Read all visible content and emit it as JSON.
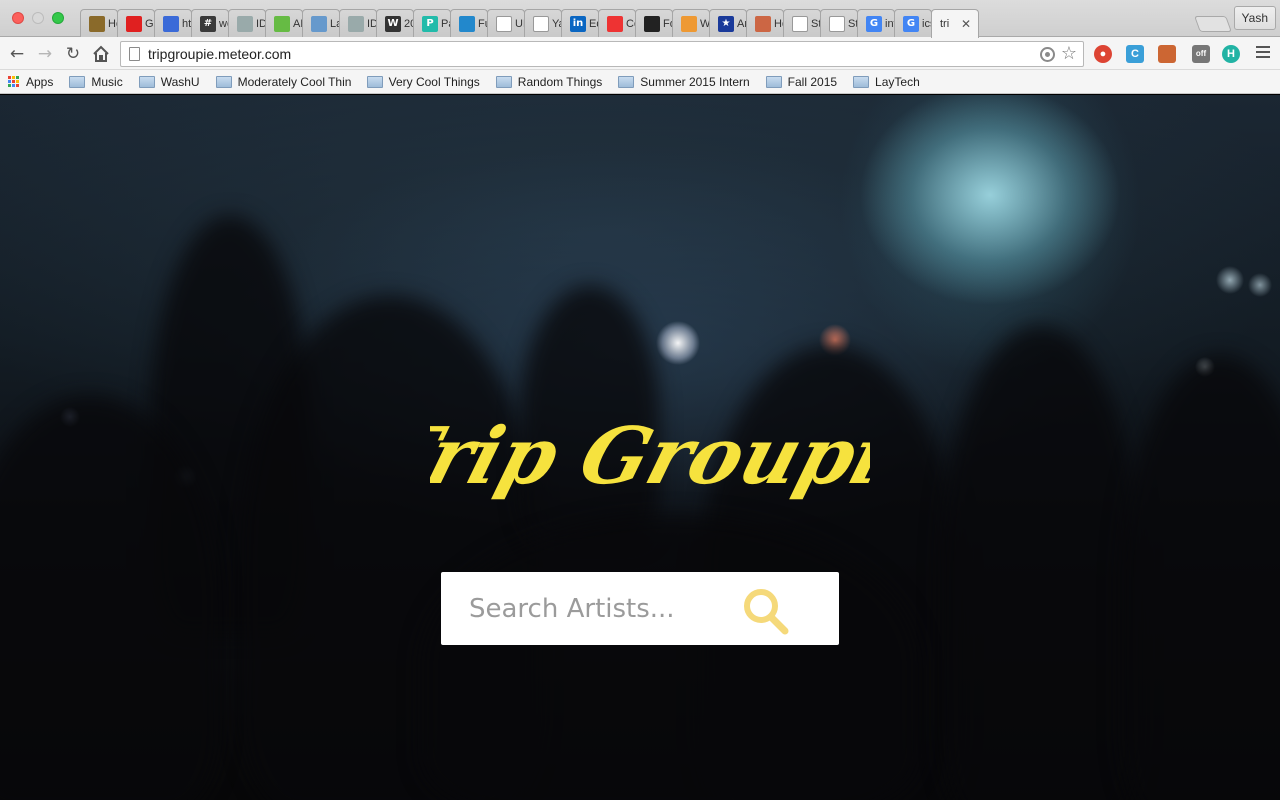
{
  "browser": {
    "profile_name": "Yash",
    "active_tab_title": "tri",
    "tabs": [
      {
        "title": "Ho",
        "icon": "dictionary-icon",
        "color": "#8a6a2a"
      },
      {
        "title": "Go",
        "icon": "red-square-icon",
        "color": "#e02020"
      },
      {
        "title": "htt",
        "icon": "mail-icon",
        "color": "#3a6ad8"
      },
      {
        "title": "we",
        "icon": "hash-icon",
        "color": "#3a3a3a"
      },
      {
        "title": "IDI",
        "icon": "bulb-icon",
        "color": "#9aa"
      },
      {
        "title": "AE",
        "icon": "leaf-icon",
        "color": "#6b4"
      },
      {
        "title": "La",
        "icon": "rocket-icon",
        "color": "#69c"
      },
      {
        "title": "ID",
        "icon": "bulb-icon",
        "color": "#9aa"
      },
      {
        "title": "20",
        "icon": "w-icon",
        "color": "#333"
      },
      {
        "title": "Pa",
        "icon": "p-icon",
        "color": "#2ba"
      },
      {
        "title": "Fu",
        "icon": "drop-icon",
        "color": "#28c"
      },
      {
        "title": "UF",
        "icon": "page-icon",
        "color": "#bbb"
      },
      {
        "title": "Ya",
        "icon": "page-icon",
        "color": "#bbb"
      },
      {
        "title": "Ed",
        "icon": "linkedin-icon",
        "color": "#0a66c2"
      },
      {
        "title": "Co",
        "icon": "color-wheel-icon",
        "color": "#e33"
      },
      {
        "title": "Fo",
        "icon": "flag-icon",
        "color": "#222"
      },
      {
        "title": "W",
        "icon": "hexagon-icon",
        "color": "#e93"
      },
      {
        "title": "An",
        "icon": "star-icon",
        "color": "#1a3a9a"
      },
      {
        "title": "Ho",
        "icon": "food-icon",
        "color": "#c64"
      },
      {
        "title": "Sty",
        "icon": "page-icon",
        "color": "#bbb"
      },
      {
        "title": "St",
        "icon": "page-icon",
        "color": "#bbb"
      },
      {
        "title": "int",
        "icon": "google-icon",
        "color": "#4285f4"
      },
      {
        "title": "ics",
        "icon": "google-icon",
        "color": "#4285f4"
      }
    ],
    "url": "tripgroupie.meteor.com",
    "bookmarks": [
      {
        "label": "Apps",
        "type": "apps"
      },
      {
        "label": "Music",
        "type": "folder"
      },
      {
        "label": "WashU",
        "type": "folder"
      },
      {
        "label": "Moderately Cool Thin",
        "type": "folder"
      },
      {
        "label": "Very Cool Things",
        "type": "folder"
      },
      {
        "label": "Random Things",
        "type": "folder"
      },
      {
        "label": "Summer 2015 Intern",
        "type": "folder"
      },
      {
        "label": "Fall 2015",
        "type": "folder"
      },
      {
        "label": "LayTech",
        "type": "folder"
      }
    ],
    "extensions": [
      {
        "icon": "stop-icon",
        "color": "#d43"
      },
      {
        "icon": "c-icon",
        "color": "#3a9fd8"
      },
      {
        "icon": "bookmark-red-icon",
        "color": "#c63"
      },
      {
        "icon": "off-icon",
        "color": "#777"
      },
      {
        "icon": "h-icon",
        "color": "#21b3a4"
      }
    ]
  },
  "page": {
    "logo_text": "Trip Groupie",
    "logo_color": "#f6e23e",
    "search_placeholder": "Search Artists...",
    "search_icon_color": "#f5d97a"
  }
}
